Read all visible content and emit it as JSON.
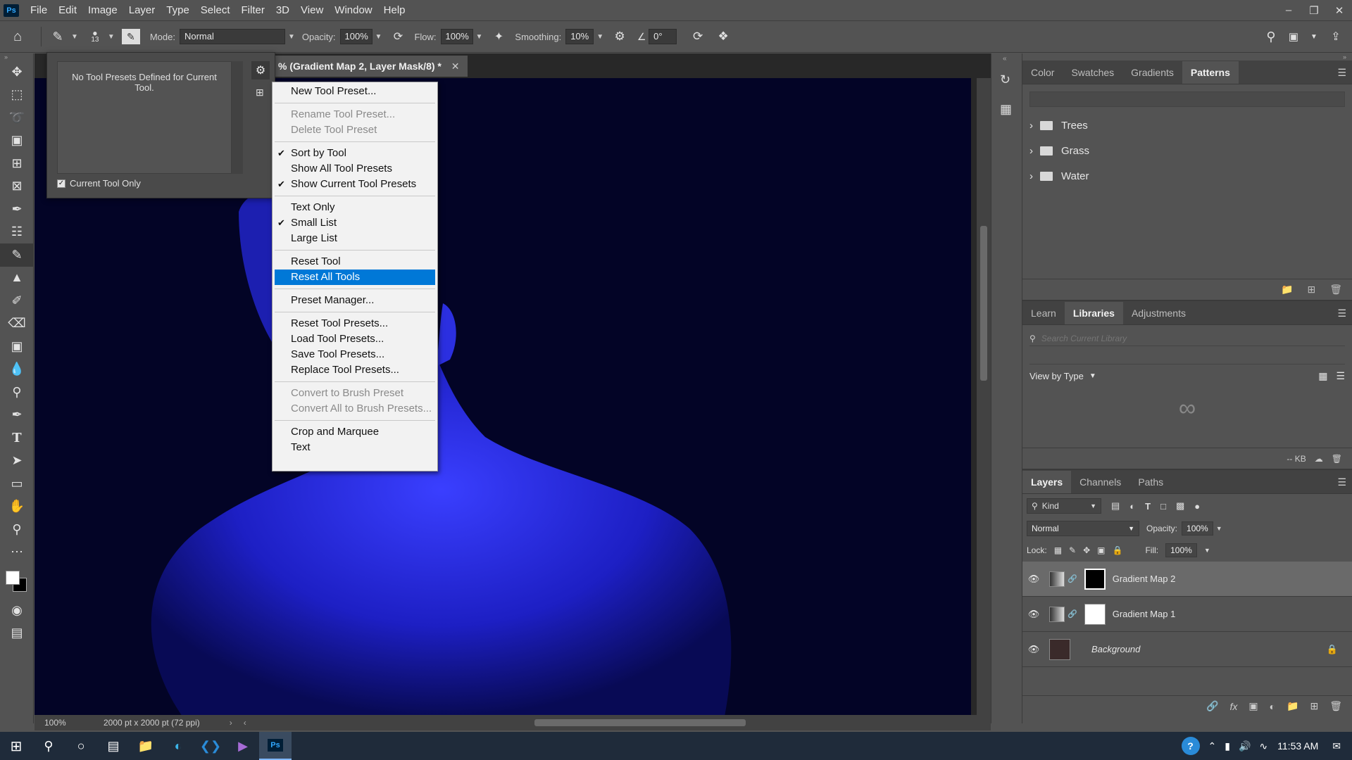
{
  "app": {
    "logo": "Ps"
  },
  "menubar": {
    "items": [
      "File",
      "Edit",
      "Image",
      "Layer",
      "Type",
      "Select",
      "Filter",
      "3D",
      "View",
      "Window",
      "Help"
    ]
  },
  "options": {
    "brush_size": "13",
    "mode_label": "Mode:",
    "mode_value": "Normal",
    "opacity_label": "Opacity:",
    "opacity_value": "100%",
    "flow_label": "Flow:",
    "flow_value": "100%",
    "smoothing_label": "Smoothing:",
    "smoothing_value": "10%",
    "angle_value": "0°"
  },
  "document": {
    "tab_title": "% (Gradient Map 2, Layer Mask/8) *",
    "zoom": "100%",
    "doc_info": "2000 pt x 2000 pt (72 ppi)"
  },
  "presets_panel": {
    "empty_message": "No Tool Presets Defined for Current Tool.",
    "current_tool_only": "Current Tool Only"
  },
  "context_menu": {
    "groups": [
      [
        {
          "label": "New Tool Preset...",
          "state": "enabled"
        }
      ],
      [
        {
          "label": "Rename Tool Preset...",
          "state": "disabled"
        },
        {
          "label": "Delete Tool Preset",
          "state": "disabled"
        }
      ],
      [
        {
          "label": "Sort by Tool",
          "state": "checked"
        },
        {
          "label": "Show All Tool Presets",
          "state": "enabled"
        },
        {
          "label": "Show Current Tool Presets",
          "state": "checked"
        }
      ],
      [
        {
          "label": "Text Only",
          "state": "enabled"
        },
        {
          "label": "Small List",
          "state": "checked"
        },
        {
          "label": "Large List",
          "state": "enabled"
        }
      ],
      [
        {
          "label": "Reset Tool",
          "state": "enabled"
        },
        {
          "label": "Reset All Tools",
          "state": "highlight"
        }
      ],
      [
        {
          "label": "Preset Manager...",
          "state": "enabled"
        }
      ],
      [
        {
          "label": "Reset Tool Presets...",
          "state": "enabled"
        },
        {
          "label": "Load Tool Presets...",
          "state": "enabled"
        },
        {
          "label": "Save Tool Presets...",
          "state": "enabled"
        },
        {
          "label": "Replace Tool Presets...",
          "state": "enabled"
        }
      ],
      [
        {
          "label": "Convert to Brush Preset",
          "state": "disabled"
        },
        {
          "label": "Convert All to Brush Presets...",
          "state": "disabled"
        }
      ],
      [
        {
          "label": "Crop and Marquee",
          "state": "enabled"
        },
        {
          "label": "Text",
          "state": "enabled"
        }
      ]
    ]
  },
  "patterns_panel": {
    "tabs": [
      "Color",
      "Swatches",
      "Gradients",
      "Patterns"
    ],
    "active_tab": "Patterns",
    "folders": [
      "Trees",
      "Grass",
      "Water"
    ]
  },
  "libraries_panel": {
    "tabs": [
      "Learn",
      "Libraries",
      "Adjustments"
    ],
    "active_tab": "Libraries",
    "search_placeholder": "Search Current Library",
    "view_by": "View by Type",
    "size": "-- KB"
  },
  "layers_panel": {
    "tabs": [
      "Layers",
      "Channels",
      "Paths"
    ],
    "active_tab": "Layers",
    "filter_kind": "Kind",
    "blend_mode": "Normal",
    "opacity_label": "Opacity:",
    "opacity_value": "100%",
    "lock_label": "Lock:",
    "fill_label": "Fill:",
    "fill_value": "100%",
    "layers": [
      {
        "name": "Gradient Map 2",
        "selected": true,
        "mask": "black"
      },
      {
        "name": "Gradient Map 1",
        "selected": false,
        "mask": "white"
      },
      {
        "name": "Background",
        "selected": false,
        "mask": "none"
      }
    ]
  },
  "taskbar": {
    "time": "11:53 AM"
  },
  "colors": {
    "canvas_bg": "#030426",
    "highlight": "#0078d7",
    "figure": "#2a2fe6"
  }
}
